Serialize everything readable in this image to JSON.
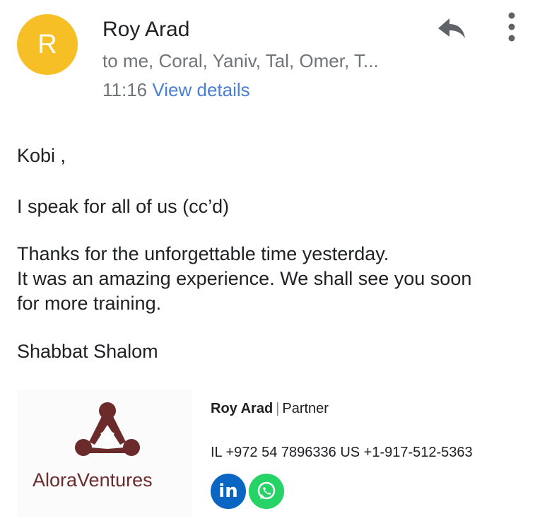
{
  "header": {
    "avatar_letter": "R",
    "sender_name": "Roy Arad",
    "recipients": "to me, Coral, Yaniv, Tal, Omer, T...",
    "time": "11:16",
    "view_details": "View details",
    "reply_icon": "reply-icon",
    "more_icon": "more-vert-icon"
  },
  "body": {
    "greeting": "Kobi ,",
    "line1": "I speak for all of us (cc’d)",
    "line2": "Thanks for the unforgettable time yesterday.",
    "line3": "It was an amazing experience. We shall see you soon",
    "line4": "for more training.",
    "closing": "Shabbat Shalom"
  },
  "signature": {
    "company": "AloraVentures",
    "name": "Roy Arad",
    "separator": "|",
    "role": "Partner",
    "phones": "IL +972 54 7896336 US +1-917-512-5363",
    "linkedin_label": "in",
    "whatsapp_icon": "whatsapp-icon"
  },
  "colors": {
    "avatar": "#f6bf26",
    "link": "#4a7fd3",
    "secondary_text": "#70757a",
    "logo_brown": "#6b2b2b",
    "linkedin": "#0a66c2",
    "whatsapp": "#25d366"
  }
}
